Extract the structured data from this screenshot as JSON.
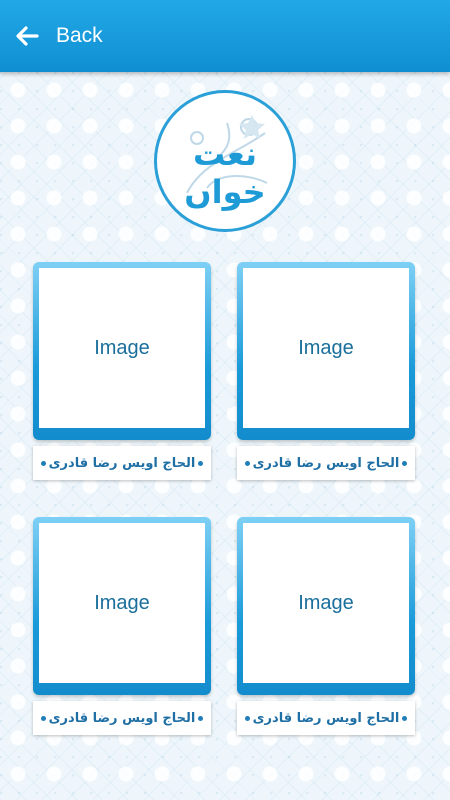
{
  "header": {
    "back_label": "Back",
    "back_icon": "arrow-left-icon",
    "color": "#1a9ee0"
  },
  "logo": {
    "text": "نعت خواں",
    "color": "#1e9ad6"
  },
  "cards": [
    {
      "image_label": "Image",
      "caption": "الحاج اویس رضا قادری"
    },
    {
      "image_label": "Image",
      "caption": "الحاج اویس رضا قادری"
    },
    {
      "image_label": "Image",
      "caption": "الحاج اویس رضا قادری"
    },
    {
      "image_label": "Image",
      "caption": "الحاج اویس رضا قادری"
    }
  ]
}
